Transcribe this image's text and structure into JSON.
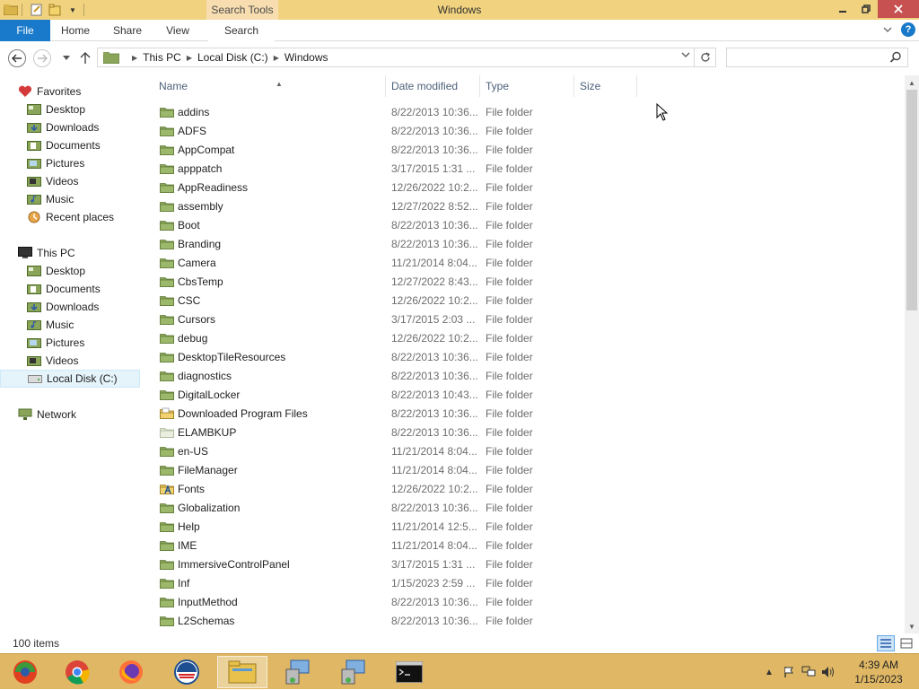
{
  "window": {
    "title": "Windows",
    "contextual_tab": "Search Tools"
  },
  "ribbon": {
    "tabs": [
      "File",
      "Home",
      "Share",
      "View",
      "Search"
    ]
  },
  "address": {
    "crumbs": [
      "This PC",
      "Local Disk (C:)",
      "Windows"
    ],
    "search_placeholder": ""
  },
  "nav": {
    "favorites_label": "Favorites",
    "favorites": [
      "Desktop",
      "Downloads",
      "Documents",
      "Pictures",
      "Videos",
      "Music",
      "Recent places"
    ],
    "thispc_label": "This PC",
    "thispc": [
      "Desktop",
      "Documents",
      "Downloads",
      "Music",
      "Pictures",
      "Videos",
      "Local Disk (C:)"
    ],
    "network_label": "Network"
  },
  "columns": {
    "name": "Name",
    "date": "Date modified",
    "type": "Type",
    "size": "Size"
  },
  "files": [
    {
      "name": "addins",
      "date": "8/22/2013 10:36...",
      "type": "File folder",
      "icon": "folder"
    },
    {
      "name": "ADFS",
      "date": "8/22/2013 10:36...",
      "type": "File folder",
      "icon": "folder"
    },
    {
      "name": "AppCompat",
      "date": "8/22/2013 10:36...",
      "type": "File folder",
      "icon": "folder"
    },
    {
      "name": "apppatch",
      "date": "3/17/2015 1:31 ...",
      "type": "File folder",
      "icon": "folder"
    },
    {
      "name": "AppReadiness",
      "date": "12/26/2022 10:2...",
      "type": "File folder",
      "icon": "folder"
    },
    {
      "name": "assembly",
      "date": "12/27/2022 8:52...",
      "type": "File folder",
      "icon": "folder"
    },
    {
      "name": "Boot",
      "date": "8/22/2013 10:36...",
      "type": "File folder",
      "icon": "folder"
    },
    {
      "name": "Branding",
      "date": "8/22/2013 10:36...",
      "type": "File folder",
      "icon": "folder"
    },
    {
      "name": "Camera",
      "date": "11/21/2014 8:04...",
      "type": "File folder",
      "icon": "folder"
    },
    {
      "name": "CbsTemp",
      "date": "12/27/2022 8:43...",
      "type": "File folder",
      "icon": "folder"
    },
    {
      "name": "CSC",
      "date": "12/26/2022 10:2...",
      "type": "File folder",
      "icon": "folder"
    },
    {
      "name": "Cursors",
      "date": "3/17/2015 2:03 ...",
      "type": "File folder",
      "icon": "folder"
    },
    {
      "name": "debug",
      "date": "12/26/2022 10:2...",
      "type": "File folder",
      "icon": "folder"
    },
    {
      "name": "DesktopTileResources",
      "date": "8/22/2013 10:36...",
      "type": "File folder",
      "icon": "folder"
    },
    {
      "name": "diagnostics",
      "date": "8/22/2013 10:36...",
      "type": "File folder",
      "icon": "folder"
    },
    {
      "name": "DigitalLocker",
      "date": "8/22/2013 10:43...",
      "type": "File folder",
      "icon": "folder"
    },
    {
      "name": "Downloaded Program Files",
      "date": "8/22/2013 10:36...",
      "type": "File folder",
      "icon": "folder-special"
    },
    {
      "name": "ELAMBKUP",
      "date": "8/22/2013 10:36...",
      "type": "File folder",
      "icon": "folder-light"
    },
    {
      "name": "en-US",
      "date": "11/21/2014 8:04...",
      "type": "File folder",
      "icon": "folder"
    },
    {
      "name": "FileManager",
      "date": "11/21/2014 8:04...",
      "type": "File folder",
      "icon": "folder"
    },
    {
      "name": "Fonts",
      "date": "12/26/2022 10:2...",
      "type": "File folder",
      "icon": "folder-fonts"
    },
    {
      "name": "Globalization",
      "date": "8/22/2013 10:36...",
      "type": "File folder",
      "icon": "folder"
    },
    {
      "name": "Help",
      "date": "11/21/2014 12:5...",
      "type": "File folder",
      "icon": "folder"
    },
    {
      "name": "IME",
      "date": "11/21/2014 8:04...",
      "type": "File folder",
      "icon": "folder"
    },
    {
      "name": "ImmersiveControlPanel",
      "date": "3/17/2015 1:31 ...",
      "type": "File folder",
      "icon": "folder"
    },
    {
      "name": "Inf",
      "date": "1/15/2023 2:59 ...",
      "type": "File folder",
      "icon": "folder"
    },
    {
      "name": "InputMethod",
      "date": "8/22/2013 10:36...",
      "type": "File folder",
      "icon": "folder"
    },
    {
      "name": "L2Schemas",
      "date": "8/22/2013 10:36...",
      "type": "File folder",
      "icon": "folder"
    }
  ],
  "status": {
    "item_count": "100 items"
  },
  "clock": {
    "time": "4:39 AM",
    "date": "1/15/2023"
  },
  "colors": {
    "title_bar": "#f1d37f",
    "file_tab": "#1979ca",
    "folder": "#8aa55a",
    "taskbar": "#e0b865"
  }
}
